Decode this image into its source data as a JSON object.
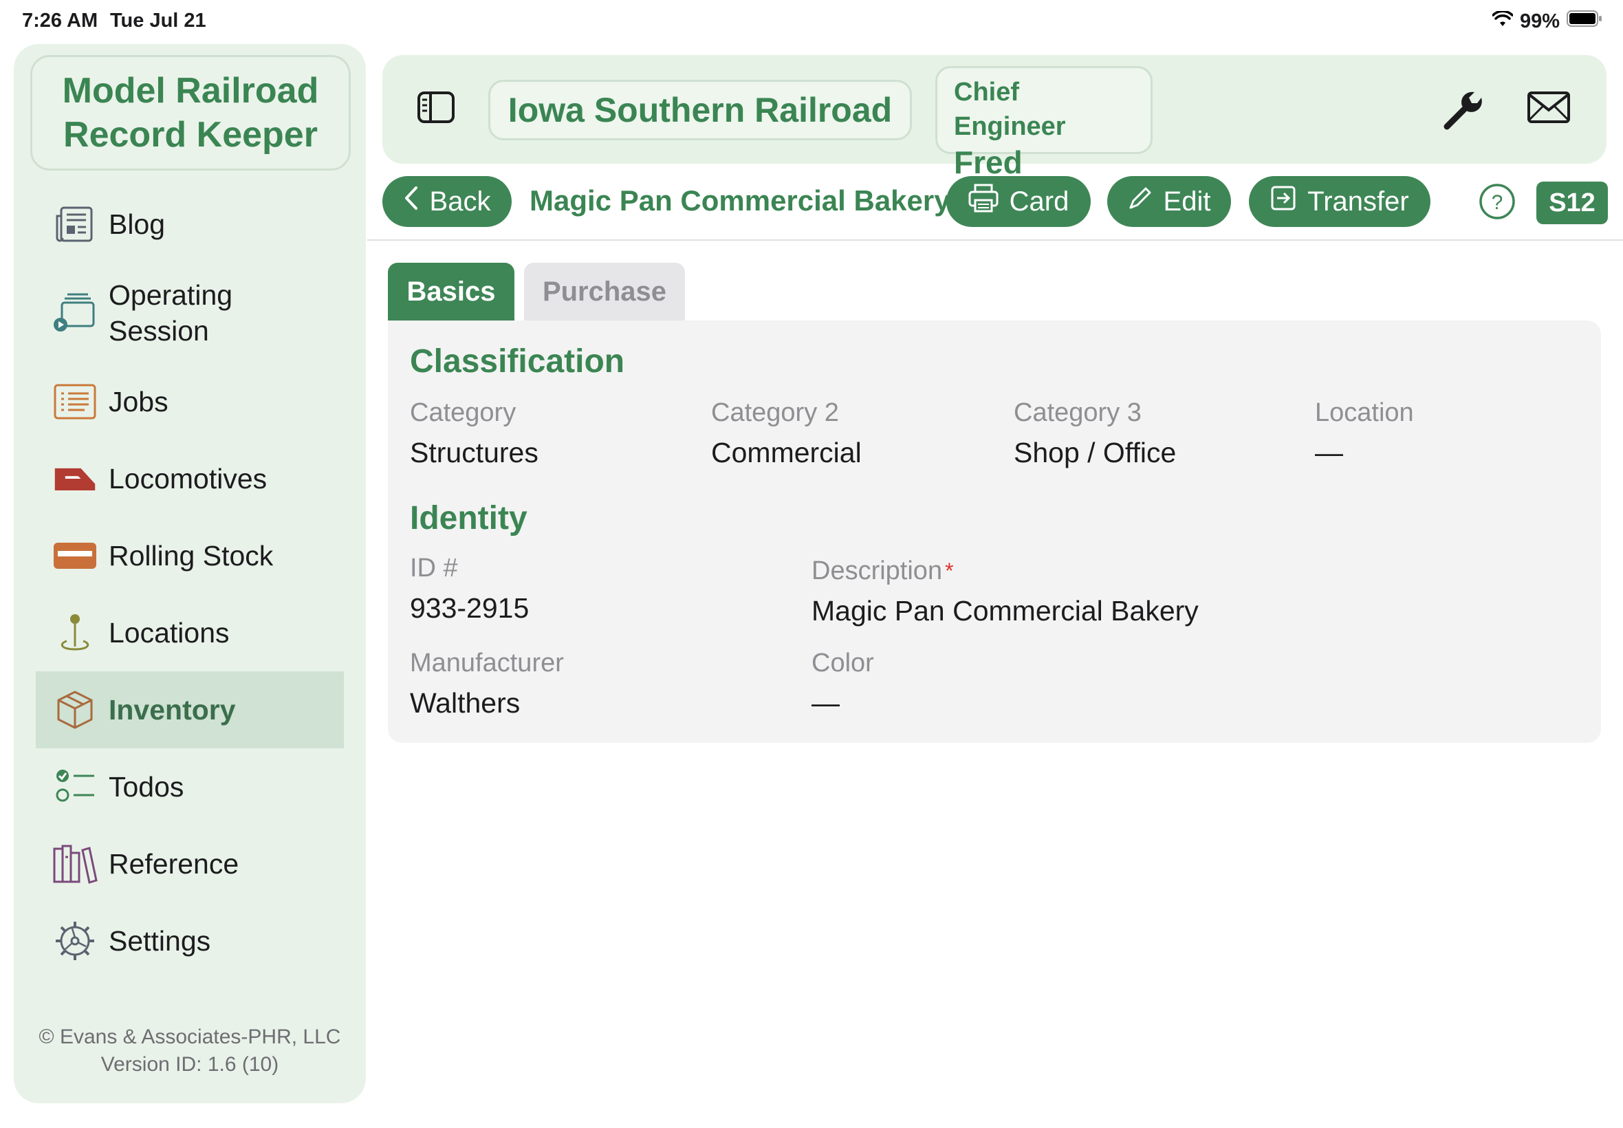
{
  "status_bar": {
    "time": "7:26 AM",
    "date": "Tue Jul 21",
    "battery": "99%"
  },
  "sidebar": {
    "app_title": "Model Railroad Record Keeper",
    "items": [
      {
        "label": "Blog",
        "icon": "newspaper-icon"
      },
      {
        "label": "Operating Session",
        "icon": "operating-session-icon"
      },
      {
        "label": "Jobs",
        "icon": "jobs-list-icon"
      },
      {
        "label": "Locomotives",
        "icon": "locomotive-icon"
      },
      {
        "label": "Rolling Stock",
        "icon": "rolling-stock-icon"
      },
      {
        "label": "Locations",
        "icon": "location-pin-icon"
      },
      {
        "label": "Inventory",
        "icon": "box-icon",
        "active": true
      },
      {
        "label": "Todos",
        "icon": "checklist-icon"
      },
      {
        "label": "Reference",
        "icon": "books-icon"
      },
      {
        "label": "Settings",
        "icon": "gear-icon"
      }
    ],
    "footer_company": "© Evans & Associates-PHR, LLC",
    "footer_version": "Version ID: 1.6 (10)"
  },
  "header": {
    "railroad_name": "Iowa Southern Railroad",
    "user_role": "Chief Engineer",
    "user_name": "Fred"
  },
  "toolbar": {
    "back_label": "Back",
    "item_title": "Magic Pan Commercial Bakery",
    "card_label": "Card",
    "edit_label": "Edit",
    "transfer_label": "Transfer",
    "scale_badge": "S12"
  },
  "tabs": [
    {
      "label": "Basics",
      "selected": true
    },
    {
      "label": "Purchase",
      "selected": false
    }
  ],
  "classification": {
    "title": "Classification",
    "category_label": "Category",
    "category_value": "Structures",
    "category2_label": "Category 2",
    "category2_value": "Commercial",
    "category3_label": "Category 3",
    "category3_value": "Shop / Office",
    "location_label": "Location",
    "location_value": "—"
  },
  "identity": {
    "title": "Identity",
    "id_label": "ID #",
    "id_value": "933-2915",
    "description_label": "Description",
    "description_required_mark": "*",
    "description_value": "Magic Pan Commercial Bakery",
    "manufacturer_label": "Manufacturer",
    "manufacturer_value": "Walthers",
    "color_label": "Color",
    "color_value": "—"
  },
  "colors": {
    "accent": "#3e8656",
    "accent_text": "#3b8553",
    "sidebar_bg": "#e9f2e9",
    "active_item_bg": "#cfe2d3",
    "required": "#e0332b"
  }
}
